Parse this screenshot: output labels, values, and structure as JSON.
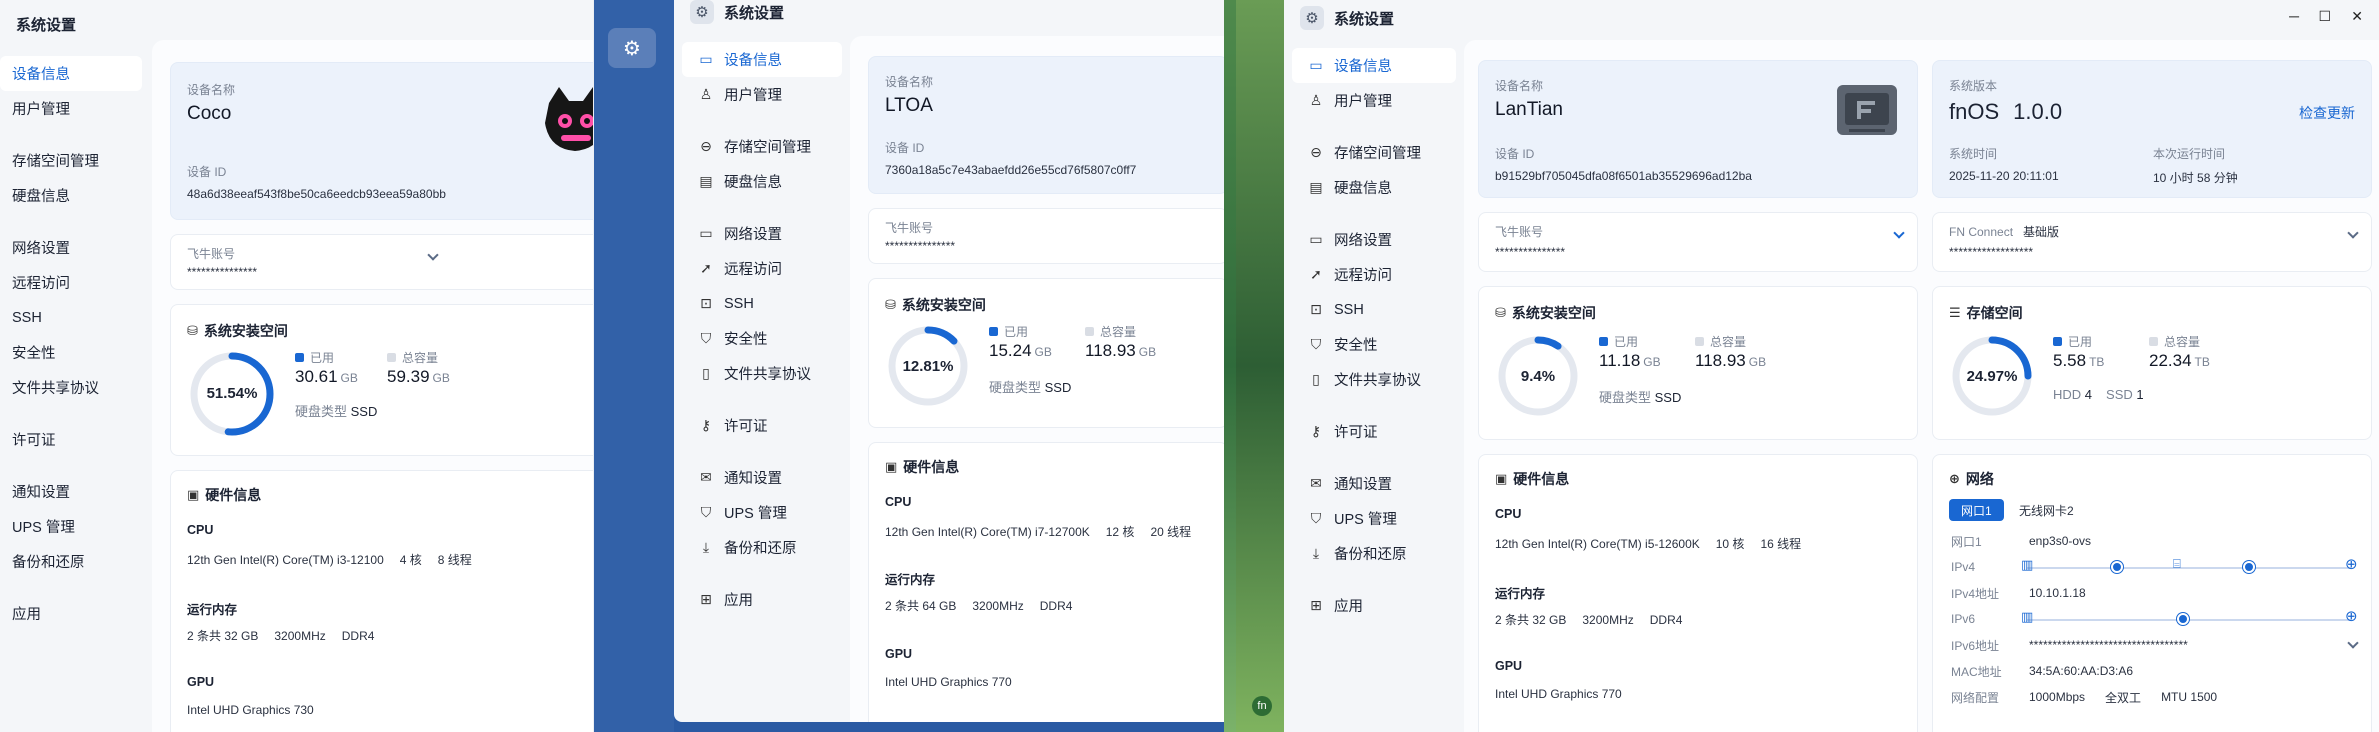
{
  "windows": [
    {
      "title": "系统设置",
      "nav": [
        {
          "label": "设备信息",
          "icon": "info-icon"
        },
        {
          "label": "用户管理",
          "icon": "user-icon"
        },
        {
          "label": "存储空间管理",
          "icon": "storage-icon"
        },
        {
          "label": "硬盘信息",
          "icon": "disk-icon"
        },
        {
          "label": "网络设置",
          "icon": "network-icon"
        },
        {
          "label": "远程访问",
          "icon": "remote-icon"
        },
        {
          "label": "SSH",
          "icon": "ssh-icon"
        },
        {
          "label": "安全性",
          "icon": "shield-icon"
        },
        {
          "label": "文件共享协议",
          "icon": "file-share-icon"
        },
        {
          "label": "许可证",
          "icon": "key-icon"
        },
        {
          "label": "通知设置",
          "icon": "mail-icon"
        },
        {
          "label": "UPS 管理",
          "icon": "ups-icon"
        },
        {
          "label": "备份和还原",
          "icon": "backup-icon"
        },
        {
          "label": "应用",
          "icon": "apps-icon"
        }
      ],
      "device": {
        "name_label": "设备名称",
        "name": "Coco",
        "id_label": "设备 ID",
        "id": "48a6d38eeaf543f8be50ca6eedcb93eea59a80bb"
      },
      "account": {
        "label": "飞牛账号",
        "value": "***************"
      },
      "install": {
        "title": "系统安装空间",
        "percent": "51.54%",
        "pct": 0.5154,
        "used_label": "已用",
        "used": "30.61",
        "used_unit": "GB",
        "total_label": "总容量",
        "total": "59.39",
        "total_unit": "GB",
        "disk_type_label": "硬盘类型",
        "disk_type": "SSD"
      },
      "hardware": {
        "title": "硬件信息",
        "cpu_label": "CPU",
        "cpu": "12th Gen Intel(R) Core(TM) i3-12100",
        "cores": "4 核",
        "threads": "8 线程",
        "mem_label": "运行内存",
        "mem": "2 条共 32 GB",
        "mem_speed": "3200MHz",
        "mem_type": "DDR4",
        "gpu_label": "GPU",
        "gpu": "Intel UHD Graphics 730"
      }
    },
    {
      "title": "系统设置",
      "device": {
        "name_label": "设备名称",
        "name": "LTOA",
        "id_label": "设备 ID",
        "id": "7360a18a5c7e43abaefdd26e55cd76f5807c0ff7"
      },
      "account": {
        "label": "飞牛账号",
        "value": "***************"
      },
      "install": {
        "title": "系统安装空间",
        "percent": "12.81%",
        "pct": 0.1281,
        "used_label": "已用",
        "used": "15.24",
        "used_unit": "GB",
        "total_label": "总容量",
        "total": "118.93",
        "total_unit": "GB",
        "disk_type_label": "硬盘类型",
        "disk_type": "SSD"
      },
      "hardware": {
        "title": "硬件信息",
        "cpu_label": "CPU",
        "cpu": "12th Gen Intel(R) Core(TM) i7-12700K",
        "cores": "12 核",
        "threads": "20 线程",
        "mem_label": "运行内存",
        "mem": "2 条共 64 GB",
        "mem_speed": "3200MHz",
        "mem_type": "DDR4",
        "gpu_label": "GPU",
        "gpu": "Intel UHD Graphics 770"
      }
    },
    {
      "title": "系统设置",
      "device": {
        "name_label": "设备名称",
        "name": "LanTian",
        "id_label": "设备 ID",
        "id": "b91529bf705045dfa08f6501ab35529696ad12ba"
      },
      "account": {
        "label": "飞牛账号",
        "value": "***************"
      },
      "install": {
        "title": "系统安装空间",
        "percent": "9.4%",
        "pct": 0.094,
        "used_label": "已用",
        "used": "11.18",
        "used_unit": "GB",
        "total_label": "总容量",
        "total": "118.93",
        "total_unit": "GB",
        "disk_type_label": "硬盘类型",
        "disk_type": "SSD"
      },
      "hardware": {
        "title": "硬件信息",
        "cpu_label": "CPU",
        "cpu": "12th Gen Intel(R) Core(TM) i5-12600K",
        "cores": "10 核",
        "threads": "16 线程",
        "mem_label": "运行内存",
        "mem": "2 条共 32 GB",
        "mem_speed": "3200MHz",
        "mem_type": "DDR4",
        "gpu_label": "GPU",
        "gpu": "Intel UHD Graphics 770"
      },
      "version": {
        "label": "系统版本",
        "name": "fnOS",
        "number": "1.0.0",
        "check": "检查更新",
        "time_label": "系统时间",
        "time": "2025-11-20 20:11:01",
        "uptime_label": "本次运行时间",
        "uptime": "10 小时 58 分钟"
      },
      "connect": {
        "label": "FN Connect",
        "tier": "基础版",
        "value": "******************"
      },
      "storage": {
        "title": "存储空间",
        "percent": "24.97%",
        "pct": 0.2497,
        "used_label": "已用",
        "used": "5.58",
        "used_unit": "TB",
        "total_label": "总容量",
        "total": "22.34",
        "total_unit": "TB",
        "hdd_label": "HDD",
        "hdd": "4",
        "ssd_label": "SSD",
        "ssd": "1"
      },
      "network": {
        "title": "网络",
        "tabs": [
          "网口1",
          "无线网卡2"
        ],
        "rows": [
          {
            "k": "网口1",
            "v": "enp3s0-ovs"
          },
          {
            "k": "IPv4",
            "v": ""
          },
          {
            "k": "IPv4地址",
            "v": "10.10.1.18"
          },
          {
            "k": "IPv6",
            "v": ""
          },
          {
            "k": "IPv6地址",
            "v": "**********************************"
          },
          {
            "k": "MAC地址",
            "v": "34:5A:60:AA:D3:A6"
          },
          {
            "k": "网络配置",
            "v": "1000Mbps",
            "v2": "全双工",
            "v3": "MTU 1500"
          }
        ]
      },
      "controls": {
        "min": "─",
        "max": "☐",
        "close": "✕"
      }
    }
  ],
  "colors": {
    "accent": "#1967d2",
    "track": "#e4e8ef"
  }
}
